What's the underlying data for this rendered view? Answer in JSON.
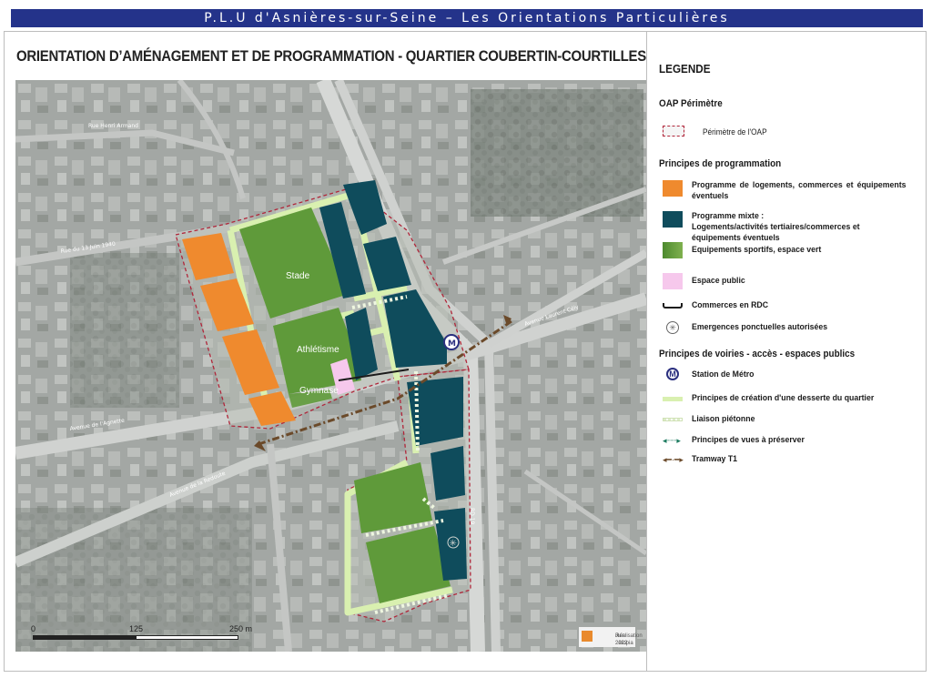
{
  "header": {
    "banner": "P.L.U d'Asnières-sur-Seine   –   Les Orientations Particulières"
  },
  "map": {
    "title": "ORIENTATION D’AMÉNAGEMENT ET DE PROGRAMMATION - QUARTIER COUBERTIN-COURTILLES",
    "zone_labels": {
      "stade": "Stade",
      "athletisme": "Athlétisme",
      "gymnase": "Gymnase"
    },
    "road_labels": {
      "rue_henri": "Rue Henri Armand",
      "rue_13_juin": "Rue du 13 Juin 1940",
      "avenue_agnettes": "Avenue de l'Agnette",
      "avenue_redoute": "Avenue de la Redoute",
      "avenue_laurent": "Avenue Laurent Cély",
      "rd19": "RD 19"
    },
    "metro_letter": "M",
    "scale": {
      "zero": "0",
      "mid": "125",
      "end": "250",
      "unit": "m"
    },
    "credit": {
      "line1": "Réalisation : atopia",
      "line2": "Juin 2022"
    }
  },
  "legend": {
    "title": "LEGENDE",
    "section_perimetre": "OAP Périmètre",
    "perimetre": "Périmètre de l'OAP",
    "section_programmation": "Principes de programmation",
    "programme_logements": "Programme de logements, commerces et équipements éventuels",
    "programme_mixte_1": "Programme mixte :",
    "programme_mixte_2": "Logements/activités tertiaires/commerces et équipements éventuels",
    "equipements": "Equipements sportifs, espace vert",
    "espace_public": "Espace public",
    "commerces": "Commerces en RDC",
    "emergences": "Emergences ponctuelles autorisées",
    "section_voiries": "Principes de voiries - accès - espaces publics",
    "station": "Station de Métro",
    "desserte": "Principes de création d'une desserte du quartier",
    "liaison": "Liaison piétonne",
    "vues": "Principes de vues à préserver",
    "tramway": "Tramway T1"
  },
  "colors": {
    "banner": "#24338a",
    "orange": "#ef8a2e",
    "teal": "#0f4c5c",
    "green": "#5f9a3a",
    "pink": "#f6c8ec",
    "desserte": "#d9f0b0",
    "perimeter": "#b0263a",
    "metro": "#2a2f7f"
  }
}
